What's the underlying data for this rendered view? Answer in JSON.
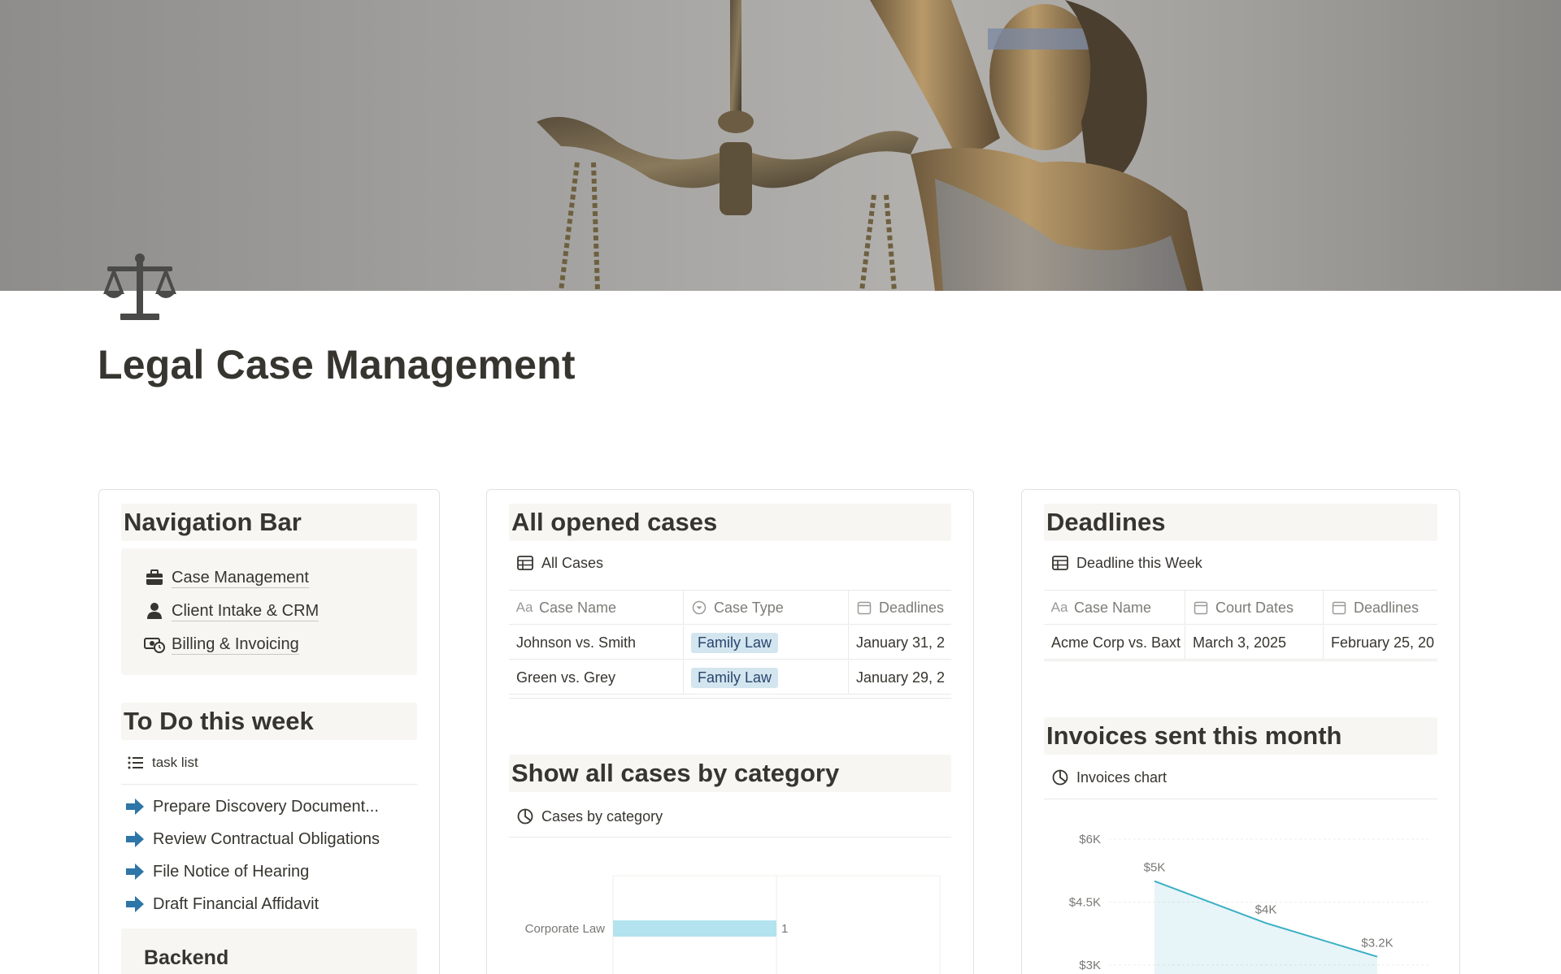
{
  "page": {
    "title": "Legal Case Management",
    "icon": "scales-of-justice-icon",
    "cover": "lady-justice-statue-photo"
  },
  "navigation": {
    "heading": "Navigation Bar",
    "items": [
      {
        "label": "Case Management",
        "icon": "briefcase-icon"
      },
      {
        "label": "Client Intake & CRM",
        "icon": "person-icon"
      },
      {
        "label": "Billing & Invoicing",
        "icon": "money-clock-icon"
      }
    ]
  },
  "todo": {
    "heading": "To Do this week",
    "view_label": "task list",
    "tasks": [
      "Prepare Discovery Document...",
      "Review Contractual Obligations",
      "File Notice of Hearing",
      "Draft Financial Affidavit"
    ]
  },
  "backend": {
    "heading": "Backend"
  },
  "cases": {
    "heading": "All opened cases",
    "view_label": "All Cases",
    "columns": [
      "Case Name",
      "Case Type",
      "Deadlines"
    ],
    "rows": [
      {
        "name": "Johnson vs. Smith",
        "type": "Family Law",
        "deadline": "January 31, 2"
      },
      {
        "name": "Green vs. Grey",
        "type": "Family Law",
        "deadline": "January 29, 2"
      }
    ]
  },
  "category": {
    "heading": "Show all cases by category",
    "view_label": "Cases by category"
  },
  "deadlines": {
    "heading": "Deadlines",
    "view_label": "Deadline this Week",
    "columns": [
      "Case Name",
      "Court Dates",
      "Deadlines"
    ],
    "rows": [
      {
        "name": "Acme Corp vs. Baxt",
        "court": "March 3, 2025",
        "deadline": "February 25, 20"
      }
    ]
  },
  "invoices": {
    "heading": "Invoices sent this month",
    "view_label": "Invoices chart"
  },
  "colors": {
    "tag_bg": "#d3e5ef",
    "bar_fill": "#b2e3ef",
    "line": "#3bb0c4",
    "arrow": "#2e76a7",
    "header_bg": "#f7f6f3"
  },
  "chart_data": [
    {
      "type": "bar",
      "orientation": "horizontal",
      "categories": [
        "Corporate Law"
      ],
      "values": [
        1
      ],
      "data_labels": [
        "1"
      ],
      "grid": true
    },
    {
      "type": "area",
      "x": [
        1,
        2,
        3
      ],
      "values": [
        5000,
        4000,
        3200
      ],
      "data_labels": [
        "$5K",
        "$4K",
        "$3.2K"
      ],
      "yticks": [
        "$6K",
        "$4.5K",
        "$3K"
      ],
      "ytick_values": [
        6000,
        4500,
        3000
      ],
      "ylim": [
        3000,
        6000
      ],
      "grid": true
    }
  ]
}
